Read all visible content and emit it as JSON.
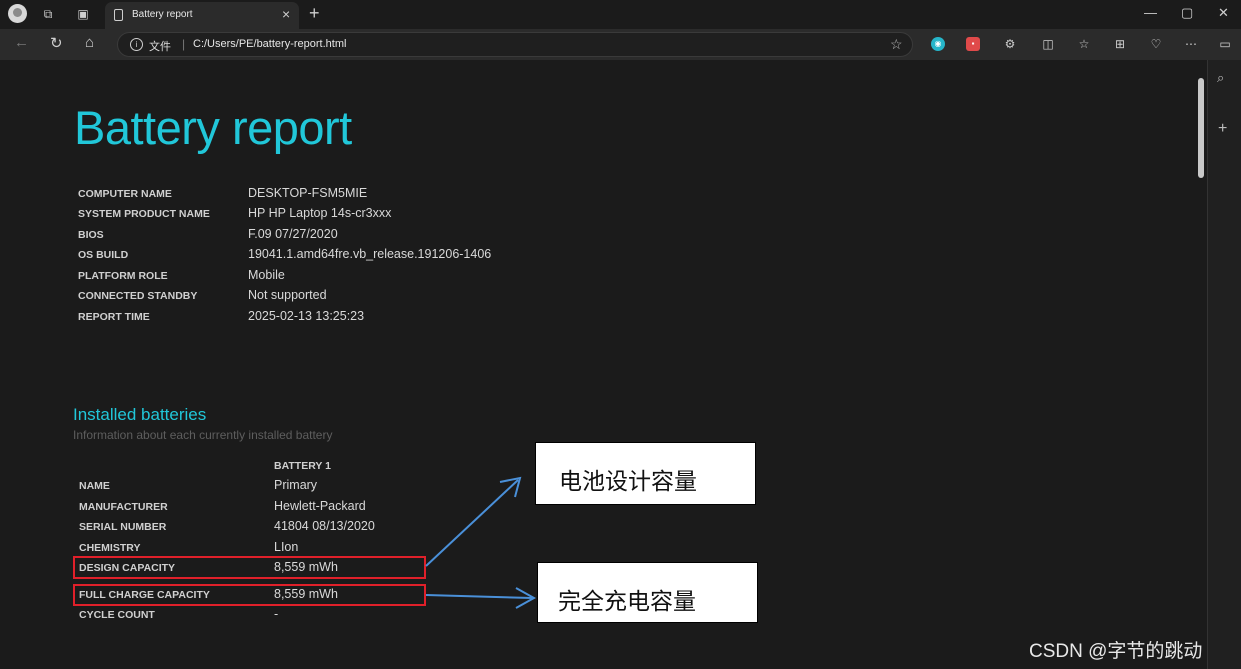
{
  "browser": {
    "tab_title": "Battery report",
    "address_prefix": "文件",
    "address_separator": "|",
    "url": "C:/Users/PE/battery-report.html"
  },
  "report": {
    "title": "Battery report",
    "info": [
      {
        "label": "COMPUTER NAME",
        "value": "DESKTOP-FSM5MIE"
      },
      {
        "label": "SYSTEM PRODUCT NAME",
        "value": "HP HP Laptop 14s-cr3xxx"
      },
      {
        "label": "BIOS",
        "value": "F.09 07/27/2020"
      },
      {
        "label": "OS BUILD",
        "value": "19041.1.amd64fre.vb_release.191206-1406"
      },
      {
        "label": "PLATFORM ROLE",
        "value": "Mobile"
      },
      {
        "label": "CONNECTED STANDBY",
        "value": "Not supported"
      },
      {
        "label": "REPORT TIME",
        "value": "2025-02-13  13:25:23"
      }
    ],
    "installed": {
      "title": "Installed batteries",
      "subtitle": "Information about each currently installed battery",
      "column_header": "BATTERY 1",
      "rows": [
        {
          "label": "NAME",
          "value": "Primary"
        },
        {
          "label": "MANUFACTURER",
          "value": "Hewlett-Packard"
        },
        {
          "label": "SERIAL NUMBER",
          "value": "41804 08/13/2020"
        },
        {
          "label": "CHEMISTRY",
          "value": "LIon"
        },
        {
          "label": "DESIGN CAPACITY",
          "value": "8,559 mWh"
        },
        {
          "label": "FULL CHARGE CAPACITY",
          "value": "8,559 mWh"
        },
        {
          "label": "CYCLE COUNT",
          "value": "-"
        }
      ]
    }
  },
  "annotations": {
    "design_capacity": "电池设计容量",
    "full_charge_capacity": "完全充电容量"
  },
  "watermark": "CSDN @字节的跳动",
  "colors": {
    "accent": "#21c7d9",
    "highlight_box": "#e0202a",
    "arrow": "#4a90d9"
  }
}
